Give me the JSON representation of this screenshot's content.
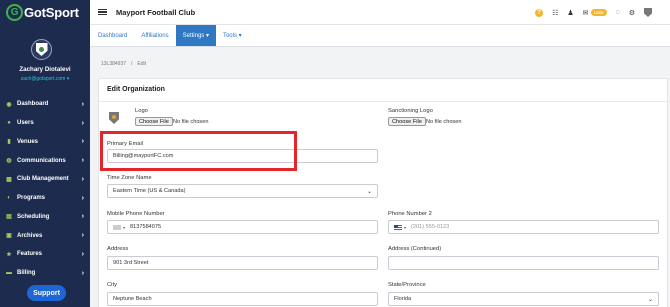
{
  "brand": {
    "name": "GotSport"
  },
  "user": {
    "name": "Zachary Diotalevi",
    "email": "zach@gotsport.com"
  },
  "sidebar": {
    "items": [
      {
        "label": "Dashboard",
        "icon": "dashboard-icon"
      },
      {
        "label": "Users",
        "icon": "users-icon"
      },
      {
        "label": "Venues",
        "icon": "venue-icon"
      },
      {
        "label": "Communications",
        "icon": "chat-icon"
      },
      {
        "label": "Club Management",
        "icon": "club-icon"
      },
      {
        "label": "Programs",
        "icon": "programs-icon"
      },
      {
        "label": "Scheduling",
        "icon": "calendar-icon"
      },
      {
        "label": "Archives",
        "icon": "archive-icon"
      },
      {
        "label": "Features",
        "icon": "star-icon"
      },
      {
        "label": "Billing",
        "icon": "billing-icon"
      }
    ],
    "support_label": "Support"
  },
  "topbar": {
    "title": "Mayport Football Club",
    "mail_badge": "1888"
  },
  "tabs": [
    {
      "label": "Dashboard"
    },
    {
      "label": "Affiliations"
    },
    {
      "label": "Settings ▾"
    },
    {
      "label": "Tools ▾"
    }
  ],
  "breadcrumb": {
    "id": "13L384937",
    "sep": "/",
    "current": "Edit"
  },
  "form": {
    "title": "Edit Organization",
    "logo_label": "Logo",
    "sanctioning_logo_label": "Sanctioning Logo",
    "choose_file": "Choose File",
    "no_file": "No file chosen",
    "primary_email_label": "Primary Email",
    "primary_email_value": "Billing@mayportFC.com",
    "time_zone_label": "Time Zone Name",
    "time_zone_value": "Eastern Time (US & Canada)",
    "mobile_phone_label": "Mobile Phone Number",
    "mobile_phone_value": "8137584075",
    "phone2_label": "Phone Number 2",
    "phone2_placeholder": "(201) 555-0123",
    "address_label": "Address",
    "address_value": "901 3rd Street",
    "address2_label": "Address (Continued)",
    "city_label": "City",
    "city_value": "Neptune Beach",
    "state_label": "State/Province",
    "state_value": "Florida"
  },
  "colors": {
    "sidebar": "#1d2b4f",
    "accent": "#2f78c4",
    "highlight": "#e3262a",
    "support": "#1e66d6"
  }
}
